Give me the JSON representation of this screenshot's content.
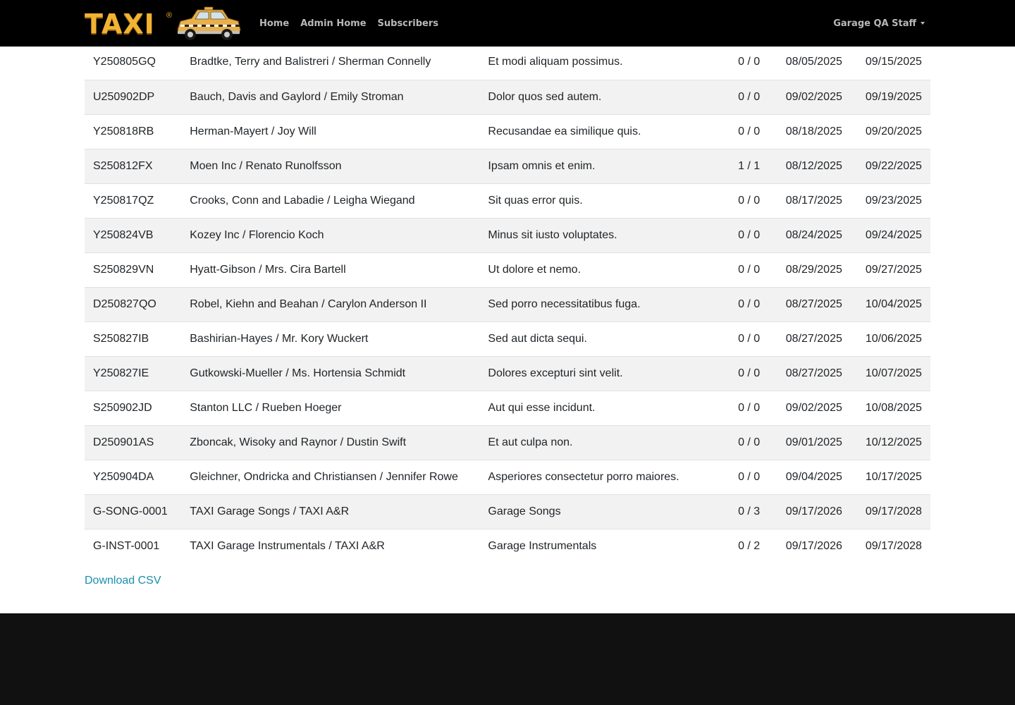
{
  "brand": {
    "name": "TAXI",
    "reg": "®"
  },
  "nav": {
    "links": [
      {
        "label": "Home"
      },
      {
        "label": "Admin Home"
      },
      {
        "label": "Subscribers"
      }
    ],
    "user": "Garage QA Staff"
  },
  "table": {
    "rows": [
      {
        "id": "Y250805GQ",
        "name": "Bradtke, Terry and Balistreri / Sherman Connelly",
        "title": "Et modi aliquam possimus.",
        "count": "0 / 0",
        "start": "08/05/2025",
        "end": "09/15/2025"
      },
      {
        "id": "U250902DP",
        "name": "Bauch, Davis and Gaylord / Emily Stroman",
        "title": "Dolor quos sed autem.",
        "count": "0 / 0",
        "start": "09/02/2025",
        "end": "09/19/2025"
      },
      {
        "id": "Y250818RB",
        "name": "Herman-Mayert / Joy Will",
        "title": "Recusandae ea similique quis.",
        "count": "0 / 0",
        "start": "08/18/2025",
        "end": "09/20/2025"
      },
      {
        "id": "S250812FX",
        "name": "Moen Inc / Renato Runolfsson",
        "title": "Ipsam omnis et enim.",
        "count": "1 / 1",
        "start": "08/12/2025",
        "end": "09/22/2025"
      },
      {
        "id": "Y250817QZ",
        "name": "Crooks, Conn and Labadie / Leigha Wiegand",
        "title": "Sit quas error quis.",
        "count": "0 / 0",
        "start": "08/17/2025",
        "end": "09/23/2025"
      },
      {
        "id": "Y250824VB",
        "name": "Kozey Inc / Florencio Koch",
        "title": "Minus sit iusto voluptates.",
        "count": "0 / 0",
        "start": "08/24/2025",
        "end": "09/24/2025"
      },
      {
        "id": "S250829VN",
        "name": "Hyatt-Gibson / Mrs. Cira Bartell",
        "title": "Ut dolore et nemo.",
        "count": "0 / 0",
        "start": "08/29/2025",
        "end": "09/27/2025"
      },
      {
        "id": "D250827QO",
        "name": "Robel, Kiehn and Beahan / Carylon Anderson II",
        "title": "Sed porro necessitatibus fuga.",
        "count": "0 / 0",
        "start": "08/27/2025",
        "end": "10/04/2025"
      },
      {
        "id": "S250827IB",
        "name": "Bashirian-Hayes / Mr. Kory Wuckert",
        "title": "Sed aut dicta sequi.",
        "count": "0 / 0",
        "start": "08/27/2025",
        "end": "10/06/2025"
      },
      {
        "id": "Y250827IE",
        "name": "Gutkowski-Mueller / Ms. Hortensia Schmidt",
        "title": "Dolores excepturi sint velit.",
        "count": "0 / 0",
        "start": "08/27/2025",
        "end": "10/07/2025"
      },
      {
        "id": "S250902JD",
        "name": "Stanton LLC / Rueben Hoeger",
        "title": "Aut qui esse incidunt.",
        "count": "0 / 0",
        "start": "09/02/2025",
        "end": "10/08/2025"
      },
      {
        "id": "D250901AS",
        "name": "Zboncak, Wisoky and Raynor / Dustin Swift",
        "title": "Et aut culpa non.",
        "count": "0 / 0",
        "start": "09/01/2025",
        "end": "10/12/2025"
      },
      {
        "id": "Y250904DA",
        "name": "Gleichner, Ondricka and Christiansen / Jennifer Rowe",
        "title": "Asperiores consectetur porro maiores.",
        "count": "0 / 0",
        "start": "09/04/2025",
        "end": "10/17/2025"
      },
      {
        "id": "G-SONG-0001",
        "name": "TAXI Garage Songs / TAXI A&R",
        "title": "Garage Songs",
        "count": "0 / 3",
        "start": "09/17/2026",
        "end": "09/17/2028"
      },
      {
        "id": "G-INST-0001",
        "name": "TAXI Garage Instrumentals / TAXI A&R",
        "title": "Garage Instrumentals",
        "count": "0 / 2",
        "start": "09/17/2026",
        "end": "09/17/2028"
      }
    ]
  },
  "download_label": "Download CSV",
  "colors": {
    "navbar": "#000000",
    "brand": "#f2b233",
    "nav_text": "#b8b8b8",
    "row_stripe": "#f2f2f2",
    "link": "#1a8fb0",
    "footer": "#111111"
  },
  "icons": {
    "logo_car": "taxi-cab-icon",
    "user_caret": "caret-down-icon"
  }
}
